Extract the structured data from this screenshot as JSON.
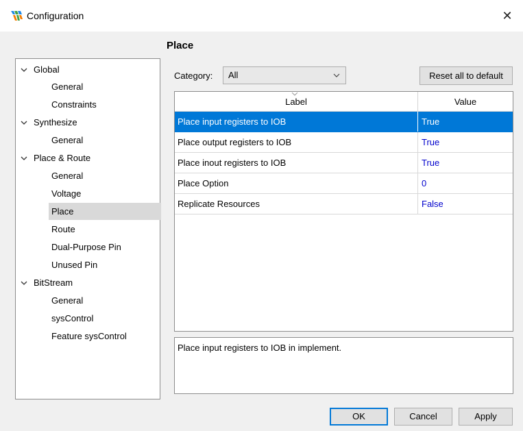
{
  "window": {
    "title": "Configuration",
    "close_glyph": "✕",
    "brand_colors": [
      "#1e88e5",
      "#43a047",
      "#f57c00"
    ]
  },
  "tree": {
    "groups": [
      {
        "label": "Global",
        "items": [
          "General",
          "Constraints"
        ]
      },
      {
        "label": "Synthesize",
        "items": [
          "General"
        ]
      },
      {
        "label": "Place & Route",
        "items": [
          "General",
          "Voltage",
          "Place",
          "Route",
          "Dual-Purpose Pin",
          "Unused Pin"
        ]
      },
      {
        "label": "BitStream",
        "items": [
          "General",
          "sysControl",
          "Feature sysControl"
        ]
      }
    ],
    "selected": "Place & Route / Place"
  },
  "page": {
    "heading": "Place",
    "category_label": "Category:",
    "category_value": "All",
    "reset_button": "Reset all to default"
  },
  "grid": {
    "columns": [
      "Label",
      "Value"
    ],
    "rows": [
      {
        "label": "Place input registers to IOB",
        "value": "True",
        "selected": true
      },
      {
        "label": "Place output registers to IOB",
        "value": "True"
      },
      {
        "label": "Place inout registers to IOB",
        "value": "True"
      },
      {
        "label": "Place Option",
        "value": "0"
      },
      {
        "label": "Replicate Resources",
        "value": "False"
      }
    ]
  },
  "description": "Place input registers to IOB in implement.",
  "buttons": {
    "ok": "OK",
    "cancel": "Cancel",
    "apply": "Apply"
  },
  "colors": {
    "selection": "#0078d7",
    "value_text": "#0000cc",
    "tree_selection": "#d9d9d9"
  }
}
